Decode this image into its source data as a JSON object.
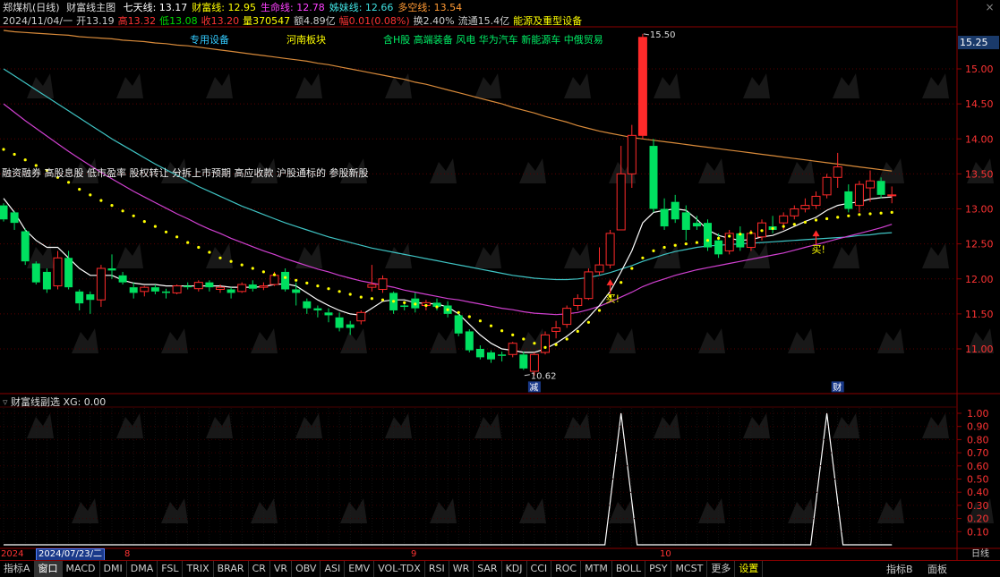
{
  "header": {
    "stock_name": "郑煤机(日线)",
    "indicator_title": "财富线主图",
    "items": [
      {
        "label": "七天线: 13.17",
        "color": "#ffffff"
      },
      {
        "label": "财富线: 12.95",
        "color": "#ffff00"
      },
      {
        "label": "生命线: 12.78",
        "color": "#ff40ff"
      },
      {
        "label": "姊妹线: 12.66",
        "color": "#40e0e0"
      },
      {
        "label": "多空线: 13.54",
        "color": "#ff9933"
      }
    ],
    "close_icon": "×"
  },
  "info_row": [
    {
      "text": "2024/11/04/一",
      "color": "#cccccc"
    },
    {
      "text": "开13.19",
      "color": "#cccccc"
    },
    {
      "text": "高13.32",
      "color": "#ff3333"
    },
    {
      "text": "低13.08",
      "color": "#00dd00"
    },
    {
      "text": "收13.20",
      "color": "#ff3333"
    },
    {
      "text": "量370547",
      "color": "#ffff00"
    },
    {
      "text": "额4.89亿",
      "color": "#cccccc"
    },
    {
      "text": "幅0.01(0.08%)",
      "color": "#ff3333"
    },
    {
      "text": "换2.40%",
      "color": "#cccccc"
    },
    {
      "text": "流通15.4亿",
      "color": "#cccccc"
    },
    {
      "text": "能源及重型设备",
      "color": "#ffff00"
    }
  ],
  "tags": [
    {
      "text": "专用设备",
      "color": "#33ccff"
    },
    {
      "text": "河南板块",
      "color": "#ffff00"
    },
    {
      "text": "含H股 高端装备 风电 华为汽车 新能源车 中俄贸易",
      "color": "#00ee66"
    }
  ],
  "concepts": "融资融券 高股息股 低市盈率 股权转让 分拆上市预期 高应收款 沪股通标的 参股新股",
  "price_box": "15.25",
  "sub_header": "财富线副选  XG: 0.00",
  "bottom_dates": {
    "left_red": "2024",
    "left_box": "2024/07/23/二",
    "m8": "8",
    "m9": "9",
    "m10": "10",
    "right": "日线"
  },
  "bottom_tabs": [
    "指标A",
    "窗口",
    "MACD",
    "DMI",
    "DMA",
    "FSL",
    "TRIX",
    "BRAR",
    "CR",
    "VR",
    "OBV",
    "ASI",
    "EMV",
    "VOL-TDX",
    "RSI",
    "WR",
    "SAR",
    "KDJ",
    "CCI",
    "ROC",
    "MTM",
    "BOLL",
    "PSY",
    "MCST",
    "更多",
    "设置"
  ],
  "side_buttons": {
    "indicator_b": "指标B",
    "panel": "面板"
  },
  "chart_data": [
    {
      "type": "candlestick",
      "title": "",
      "ylim": [
        10.62,
        15.5
      ],
      "y_ticks": [
        11.0,
        11.5,
        12.0,
        12.5,
        13.0,
        13.5,
        14.0,
        14.5,
        15.0
      ],
      "annotations": [
        {
          "label": "15.50",
          "x_index": 59,
          "y": 15.5
        },
        {
          "label": "10.62",
          "x_index": 48,
          "y": 10.62
        },
        {
          "label": "买!",
          "x_index": 56,
          "y": 11.75
        },
        {
          "label": "买!",
          "x_index": 75,
          "y": 12.45
        },
        {
          "label": "减",
          "x_index": 49,
          "y": 10.42
        },
        {
          "label": "财",
          "x_index": 77,
          "y": 10.42
        }
      ],
      "candles": [
        {
          "o": 13.05,
          "h": 13.08,
          "c": 12.85,
          "l": 12.82
        },
        {
          "o": 12.95,
          "h": 12.97,
          "c": 12.8,
          "l": 12.7
        },
        {
          "o": 12.68,
          "h": 12.72,
          "c": 12.25,
          "l": 12.2
        },
        {
          "o": 12.22,
          "h": 12.25,
          "c": 11.95,
          "l": 11.92
        },
        {
          "o": 12.1,
          "h": 12.15,
          "c": 11.85,
          "l": 11.8
        },
        {
          "o": 11.9,
          "h": 12.4,
          "c": 12.3,
          "l": 11.85
        },
        {
          "o": 12.3,
          "h": 12.4,
          "c": 11.88,
          "l": 11.85
        },
        {
          "o": 11.82,
          "h": 11.85,
          "c": 11.65,
          "l": 11.55
        },
        {
          "o": 11.78,
          "h": 11.82,
          "c": 11.7,
          "l": 11.5
        },
        {
          "o": 11.7,
          "h": 12.2,
          "c": 12.15,
          "l": 11.6
        },
        {
          "o": 12.15,
          "h": 12.35,
          "c": 12.12,
          "l": 12.0
        },
        {
          "o": 12.05,
          "h": 12.1,
          "c": 11.95,
          "l": 11.92
        },
        {
          "o": 11.88,
          "h": 11.95,
          "c": 11.8,
          "l": 11.72
        },
        {
          "o": 11.82,
          "h": 11.9,
          "c": 11.88,
          "l": 11.75
        },
        {
          "o": 11.88,
          "h": 11.92,
          "c": 11.82,
          "l": 11.78
        },
        {
          "o": 11.82,
          "h": 11.86,
          "c": 11.8,
          "l": 11.72
        },
        {
          "o": 11.8,
          "h": 11.92,
          "c": 11.9,
          "l": 11.78
        },
        {
          "o": 11.9,
          "h": 11.95,
          "c": 11.88,
          "l": 11.85
        },
        {
          "o": 11.86,
          "h": 11.98,
          "c": 11.95,
          "l": 11.82
        },
        {
          "o": 11.95,
          "h": 11.98,
          "c": 11.88,
          "l": 11.82
        },
        {
          "o": 11.85,
          "h": 11.92,
          "c": 11.88,
          "l": 11.8
        },
        {
          "o": 11.85,
          "h": 11.88,
          "c": 11.8,
          "l": 11.72
        },
        {
          "o": 11.82,
          "h": 11.95,
          "c": 11.92,
          "l": 11.8
        },
        {
          "o": 11.92,
          "h": 11.98,
          "c": 11.86,
          "l": 11.82
        },
        {
          "o": 11.88,
          "h": 11.95,
          "c": 11.9,
          "l": 11.84
        },
        {
          "o": 11.92,
          "h": 12.1,
          "c": 12.05,
          "l": 11.9
        },
        {
          "o": 12.1,
          "h": 12.15,
          "c": 11.85,
          "l": 11.82
        },
        {
          "o": 11.85,
          "h": 11.95,
          "c": 11.8,
          "l": 11.62
        },
        {
          "o": 11.68,
          "h": 11.72,
          "c": 11.58,
          "l": 11.5
        },
        {
          "o": 11.58,
          "h": 11.62,
          "c": 11.55,
          "l": 11.45
        },
        {
          "o": 11.52,
          "h": 11.58,
          "c": 11.48,
          "l": 11.38
        },
        {
          "o": 11.45,
          "h": 11.52,
          "c": 11.3,
          "l": 11.25
        },
        {
          "o": 11.35,
          "h": 11.4,
          "c": 11.3,
          "l": 11.2
        },
        {
          "o": 11.4,
          "h": 11.55,
          "c": 11.52,
          "l": 11.35
        },
        {
          "o": 11.88,
          "h": 12.2,
          "c": 11.92,
          "l": 11.82
        },
        {
          "o": 11.85,
          "h": 12.05,
          "c": 12.0,
          "l": 11.8
        },
        {
          "o": 11.8,
          "h": 11.82,
          "c": 11.55,
          "l": 11.5
        },
        {
          "o": 11.62,
          "h": 11.68,
          "c": 11.6,
          "l": 11.55
        },
        {
          "o": 11.72,
          "h": 11.8,
          "c": 11.58,
          "l": 11.52
        },
        {
          "o": 11.62,
          "h": 11.7,
          "c": 11.66,
          "l": 11.55
        },
        {
          "o": 11.66,
          "h": 11.72,
          "c": 11.6,
          "l": 11.55
        },
        {
          "o": 11.62,
          "h": 11.68,
          "c": 11.5,
          "l": 11.45
        },
        {
          "o": 11.48,
          "h": 11.52,
          "c": 11.22,
          "l": 11.18
        },
        {
          "o": 11.25,
          "h": 11.28,
          "c": 10.98,
          "l": 10.95
        },
        {
          "o": 11.0,
          "h": 11.05,
          "c": 10.88,
          "l": 10.85
        },
        {
          "o": 10.95,
          "h": 10.98,
          "c": 10.85,
          "l": 10.8
        },
        {
          "o": 10.92,
          "h": 10.96,
          "c": 10.9,
          "l": 10.82
        },
        {
          "o": 10.92,
          "h": 11.1,
          "c": 11.08,
          "l": 10.88
        },
        {
          "o": 10.92,
          "h": 10.96,
          "c": 10.72,
          "l": 10.7
        },
        {
          "o": 10.68,
          "h": 10.95,
          "c": 10.92,
          "l": 10.62
        },
        {
          "o": 10.95,
          "h": 11.25,
          "c": 11.2,
          "l": 10.92
        },
        {
          "o": 11.25,
          "h": 11.4,
          "c": 11.3,
          "l": 11.15
        },
        {
          "o": 11.35,
          "h": 11.62,
          "c": 11.58,
          "l": 11.3
        },
        {
          "o": 11.62,
          "h": 11.78,
          "c": 11.72,
          "l": 11.55
        },
        {
          "o": 11.72,
          "h": 12.15,
          "c": 12.1,
          "l": 11.7
        },
        {
          "o": 12.1,
          "h": 12.45,
          "c": 12.2,
          "l": 12.05
        },
        {
          "o": 12.2,
          "h": 12.7,
          "c": 12.65,
          "l": 12.15
        },
        {
          "o": 12.7,
          "h": 13.9,
          "c": 13.5,
          "l": 12.7
        },
        {
          "o": 13.5,
          "h": 14.2,
          "c": 14.05,
          "l": 13.3
        },
        {
          "o": 14.05,
          "h": 15.5,
          "c": 15.45,
          "l": 14.0
        },
        {
          "o": 13.9,
          "h": 14.0,
          "c": 13.0,
          "l": 12.95
        },
        {
          "o": 13.0,
          "h": 13.15,
          "c": 12.75,
          "l": 12.7
        },
        {
          "o": 13.1,
          "h": 13.2,
          "c": 12.85,
          "l": 12.8
        },
        {
          "o": 12.95,
          "h": 13.05,
          "c": 12.7,
          "l": 12.55
        },
        {
          "o": 12.8,
          "h": 12.9,
          "c": 12.75,
          "l": 12.7
        },
        {
          "o": 12.8,
          "h": 12.85,
          "c": 12.45,
          "l": 12.4
        },
        {
          "o": 12.55,
          "h": 12.65,
          "c": 12.35,
          "l": 12.3
        },
        {
          "o": 12.4,
          "h": 12.7,
          "c": 12.65,
          "l": 12.35
        },
        {
          "o": 12.65,
          "h": 12.75,
          "c": 12.45,
          "l": 12.4
        },
        {
          "o": 12.45,
          "h": 12.7,
          "c": 12.65,
          "l": 12.4
        },
        {
          "o": 12.6,
          "h": 12.85,
          "c": 12.8,
          "l": 12.55
        },
        {
          "o": 12.75,
          "h": 12.9,
          "c": 12.7,
          "l": 12.65
        },
        {
          "o": 12.8,
          "h": 12.95,
          "c": 12.9,
          "l": 12.7
        },
        {
          "o": 12.9,
          "h": 13.05,
          "c": 13.0,
          "l": 12.85
        },
        {
          "o": 13.0,
          "h": 13.15,
          "c": 13.05,
          "l": 12.95
        },
        {
          "o": 13.05,
          "h": 13.25,
          "c": 13.18,
          "l": 13.0
        },
        {
          "o": 13.2,
          "h": 13.5,
          "c": 13.45,
          "l": 13.15
        },
        {
          "o": 13.45,
          "h": 13.8,
          "c": 13.6,
          "l": 13.3
        },
        {
          "o": 13.25,
          "h": 13.35,
          "c": 13.0,
          "l": 12.95
        },
        {
          "o": 13.05,
          "h": 13.4,
          "c": 13.35,
          "l": 12.95
        },
        {
          "o": 13.3,
          "h": 13.55,
          "c": 13.4,
          "l": 13.1
        },
        {
          "o": 13.4,
          "h": 13.45,
          "c": 13.2,
          "l": 13.15
        },
        {
          "o": 13.19,
          "h": 13.32,
          "c": 13.2,
          "l": 13.08
        }
      ],
      "lines": {
        "seven_day": [
          13.15,
          12.95,
          12.7,
          12.55,
          12.45,
          12.45,
          12.3,
          12.15,
          12.05,
          12.05,
          12.05,
          11.98,
          11.94,
          11.92,
          11.92,
          11.9,
          11.9,
          11.9,
          11.9,
          11.9,
          11.9,
          11.88,
          11.88,
          11.88,
          11.89,
          11.92,
          11.93,
          11.9,
          11.8,
          11.7,
          11.62,
          11.55,
          11.5,
          11.48,
          11.58,
          11.68,
          11.7,
          11.7,
          11.66,
          11.65,
          11.64,
          11.6,
          11.5,
          11.35,
          11.2,
          11.08,
          11.0,
          10.98,
          10.95,
          10.95,
          11.0,
          11.08,
          11.18,
          11.3,
          11.45,
          11.62,
          11.82,
          12.1,
          12.4,
          12.8,
          12.95,
          12.98,
          13.0,
          12.98,
          12.85,
          12.7,
          12.62,
          12.58,
          12.55,
          12.56,
          12.6,
          12.62,
          12.68,
          12.75,
          12.82,
          12.88,
          12.98,
          13.05,
          13.08,
          13.1,
          13.14,
          13.16,
          13.17
        ],
        "wealth": [
          13.85,
          13.78,
          13.7,
          13.62,
          13.55,
          13.45,
          13.38,
          13.28,
          13.2,
          13.12,
          13.05,
          12.97,
          12.9,
          12.82,
          12.75,
          12.67,
          12.6,
          12.52,
          12.45,
          12.38,
          12.3,
          12.25,
          12.2,
          12.15,
          12.1,
          12.06,
          12.02,
          11.98,
          11.94,
          11.9,
          11.86,
          11.82,
          11.78,
          11.74,
          11.72,
          11.7,
          11.68,
          11.66,
          11.64,
          11.62,
          11.6,
          11.56,
          11.52,
          11.46,
          11.4,
          11.33,
          11.26,
          11.2,
          11.14,
          11.08,
          11.02,
          11.06,
          11.14,
          11.25,
          11.38,
          11.55,
          11.75,
          11.95,
          12.15,
          12.3,
          12.4,
          12.45,
          12.48,
          12.5,
          12.52,
          12.55,
          12.58,
          12.61,
          12.64,
          12.66,
          12.69,
          12.72,
          12.75,
          12.78,
          12.81,
          12.84,
          12.86,
          12.88,
          12.9,
          12.92,
          12.93,
          12.94,
          12.95
        ],
        "life": [
          14.5,
          14.38,
          14.26,
          14.15,
          14.04,
          13.93,
          13.82,
          13.72,
          13.62,
          13.52,
          13.43,
          13.34,
          13.25,
          13.17,
          13.09,
          13.01,
          12.93,
          12.86,
          12.78,
          12.71,
          12.65,
          12.58,
          12.52,
          12.46,
          12.4,
          12.35,
          12.29,
          12.24,
          12.19,
          12.14,
          12.1,
          12.05,
          12.01,
          11.97,
          11.94,
          11.91,
          11.88,
          11.84,
          11.81,
          11.78,
          11.75,
          11.72,
          11.7,
          11.67,
          11.64,
          11.61,
          11.58,
          11.56,
          11.53,
          11.51,
          11.5,
          11.49,
          11.5,
          11.52,
          11.56,
          11.61,
          11.67,
          11.74,
          11.81,
          11.89,
          11.95,
          12.0,
          12.05,
          12.09,
          12.13,
          12.16,
          12.19,
          12.22,
          12.25,
          12.28,
          12.31,
          12.34,
          12.37,
          12.41,
          12.45,
          12.49,
          12.53,
          12.57,
          12.61,
          12.65,
          12.69,
          12.73,
          12.78
        ],
        "sister": [
          15.0,
          14.9,
          14.8,
          14.7,
          14.6,
          14.5,
          14.4,
          14.3,
          14.2,
          14.1,
          14.0,
          13.91,
          13.82,
          13.73,
          13.64,
          13.56,
          13.48,
          13.4,
          13.32,
          13.25,
          13.18,
          13.11,
          13.04,
          12.98,
          12.92,
          12.86,
          12.8,
          12.75,
          12.7,
          12.65,
          12.6,
          12.56,
          12.52,
          12.48,
          12.44,
          12.41,
          12.38,
          12.35,
          12.32,
          12.29,
          12.26,
          12.23,
          12.2,
          12.17,
          12.14,
          12.11,
          12.08,
          12.05,
          12.03,
          12.01,
          12.0,
          11.99,
          11.99,
          12.0,
          12.02,
          12.05,
          12.09,
          12.14,
          12.19,
          12.25,
          12.3,
          12.35,
          12.39,
          12.42,
          12.45,
          12.47,
          12.48,
          12.49,
          12.5,
          12.51,
          12.52,
          12.53,
          12.54,
          12.55,
          12.56,
          12.57,
          12.58,
          12.59,
          12.6,
          12.62,
          12.63,
          12.65,
          12.66
        ],
        "long_short": [
          15.55,
          15.53,
          15.52,
          15.51,
          15.5,
          15.49,
          15.48,
          15.46,
          15.45,
          15.44,
          15.43,
          15.41,
          15.4,
          15.39,
          15.37,
          15.36,
          15.34,
          15.33,
          15.31,
          15.29,
          15.27,
          15.25,
          15.23,
          15.21,
          15.19,
          15.17,
          15.15,
          15.13,
          15.11,
          15.08,
          15.06,
          15.03,
          15.0,
          14.97,
          14.94,
          14.91,
          14.88,
          14.85,
          14.81,
          14.78,
          14.74,
          14.7,
          14.66,
          14.62,
          14.58,
          14.54,
          14.5,
          14.45,
          14.41,
          14.37,
          14.32,
          14.28,
          14.24,
          14.19,
          14.15,
          14.11,
          14.08,
          14.05,
          14.02,
          14.0,
          13.98,
          13.96,
          13.94,
          13.92,
          13.9,
          13.88,
          13.86,
          13.84,
          13.82,
          13.8,
          13.78,
          13.76,
          13.74,
          13.72,
          13.7,
          13.68,
          13.66,
          13.64,
          13.62,
          13.6,
          13.58,
          13.56,
          13.54
        ]
      }
    },
    {
      "type": "line",
      "title": "",
      "ylim": [
        0,
        1.0
      ],
      "y_ticks": [
        0.1,
        0.2,
        0.3,
        0.4,
        0.5,
        0.6,
        0.7,
        0.8,
        0.9,
        1.0
      ],
      "signal_peaks": [
        57,
        76
      ],
      "series": [
        {
          "name": "XG",
          "color": "#ffffff"
        }
      ]
    }
  ]
}
